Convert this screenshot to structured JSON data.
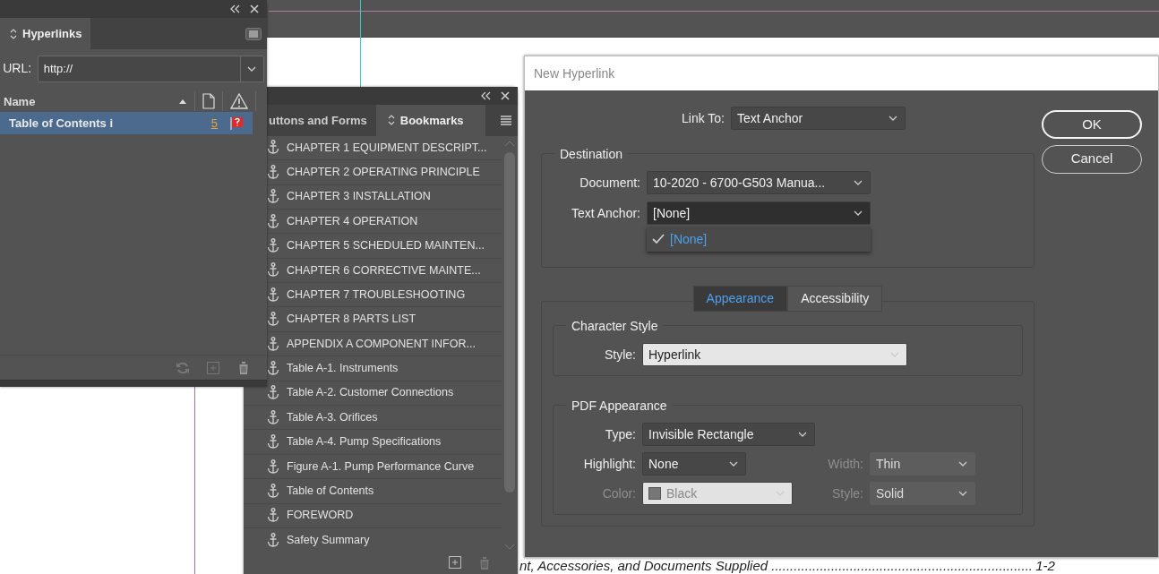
{
  "hyperlinks_panel": {
    "tab": "Hyperlinks",
    "url_label": "URL:",
    "url_value": "http://",
    "column": "Name",
    "rows": [
      {
        "name": "Table of Contents i",
        "page": "5",
        "selected": true
      }
    ]
  },
  "bookmarks_panel": {
    "tabs": [
      {
        "label": "uttons and Forms",
        "selected": false
      },
      {
        "label": "Bookmarks",
        "selected": true
      }
    ],
    "items": [
      {
        "label": "CHAPTER 1 EQUIPMENT DESCRIPT..."
      },
      {
        "label": "CHAPTER 2  OPERATING PRINCIPLE"
      },
      {
        "label": "CHAPTER 3  INSTALLATION"
      },
      {
        "label": "CHAPTER 4  OPERATION"
      },
      {
        "label": "CHAPTER 5  SCHEDULED MAINTEN..."
      },
      {
        "label": "CHAPTER 6  CORRECTIVE MAINTE..."
      },
      {
        "label": "CHAPTER 7 TROUBLESHOOTING"
      },
      {
        "label": "CHAPTER 8  PARTS LIST"
      },
      {
        "label": "APPENDIX A  COMPONENT INFOR..."
      },
      {
        "label": "Table A-1. Instruments"
      },
      {
        "label": "Table A-2. Customer Connections"
      },
      {
        "label": "Table A-3. Orifices"
      },
      {
        "label": "Table A-4. Pump Specifications"
      },
      {
        "label": "Figure A-1. Pump Performance Curve"
      },
      {
        "label": "Table of Contents"
      },
      {
        "label": "FOREWORD"
      },
      {
        "label": "Safety Summary"
      }
    ]
  },
  "dialog": {
    "title": "New Hyperlink",
    "link_to": {
      "label": "Link To:",
      "value": "Text Anchor"
    },
    "destination": {
      "legend": "Destination",
      "document": {
        "label": "Document:",
        "value": "10-2020 - 6700-G503 Manua..."
      },
      "text_anchor": {
        "label": "Text Anchor:",
        "value": "[None]",
        "options": [
          {
            "label": "[None]",
            "checked": true
          }
        ]
      }
    },
    "buttons": [
      {
        "label": "OK",
        "default": true
      },
      {
        "label": "Cancel",
        "default": false
      }
    ],
    "tabs": [
      {
        "label": "Appearance",
        "selected": true
      },
      {
        "label": "Accessibility",
        "selected": false
      }
    ],
    "character_style": {
      "legend": "Character Style",
      "style": {
        "label": "Style:",
        "value": "Hyperlink"
      }
    },
    "pdf_appearance": {
      "legend": "PDF Appearance",
      "fields": [
        {
          "label": "Type:",
          "value": "Invisible Rectangle",
          "disabled": false
        },
        {
          "label": "Highlight:",
          "value": "None",
          "disabled": false
        },
        {
          "label": "Width:",
          "value": "Thin",
          "disabled": true
        },
        {
          "label": "Color:",
          "value": "Black",
          "disabled": true,
          "kind": "swatch"
        },
        {
          "label": "Style:",
          "value": "Solid",
          "disabled": true
        }
      ]
    }
  },
  "document": {
    "line": "nt, Accessories, and Documents Supplied ......................................................................",
    "page": "1-2"
  }
}
